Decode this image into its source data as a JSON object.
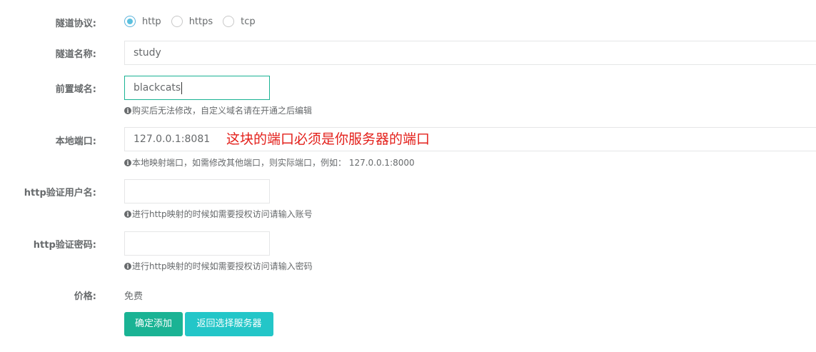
{
  "form": {
    "protocol": {
      "label": "隧道协议:",
      "options": [
        {
          "label": "http",
          "checked": true
        },
        {
          "label": "https",
          "checked": false
        },
        {
          "label": "tcp",
          "checked": false
        }
      ]
    },
    "tunnel_name": {
      "label": "隧道名称:",
      "value": "study"
    },
    "prefix_domain": {
      "label": "前置域名:",
      "value": "blackcats",
      "help": "购买后无法修改，自定义域名请在开通之后编辑"
    },
    "local_port": {
      "label": "本地端口:",
      "value": "127.0.0.1:8081",
      "help": "本地映射端口，如需修改其他端口，则实际端口，例如： 127.0.0.1:8000"
    },
    "http_user": {
      "label": "http验证用户名:",
      "value": "",
      "help": "进行http映射的时候如需要授权访问请输入账号"
    },
    "http_password": {
      "label": "http验证密码:",
      "value": "",
      "help": "进行http映射的时候如需要授权访问请输入密码"
    },
    "price": {
      "label": "价格:",
      "value": "免费"
    },
    "buttons": {
      "confirm": "确定添加",
      "back": "返回选择服务器"
    }
  },
  "annotation": {
    "text": "这块的端口必须是你服务器的端口",
    "color": "#e3201b"
  },
  "colors": {
    "primary": "#1ab394",
    "info": "#23c6c8",
    "radio_checked": "#5bc0de"
  },
  "icons": {
    "help": "info-circle-icon"
  }
}
